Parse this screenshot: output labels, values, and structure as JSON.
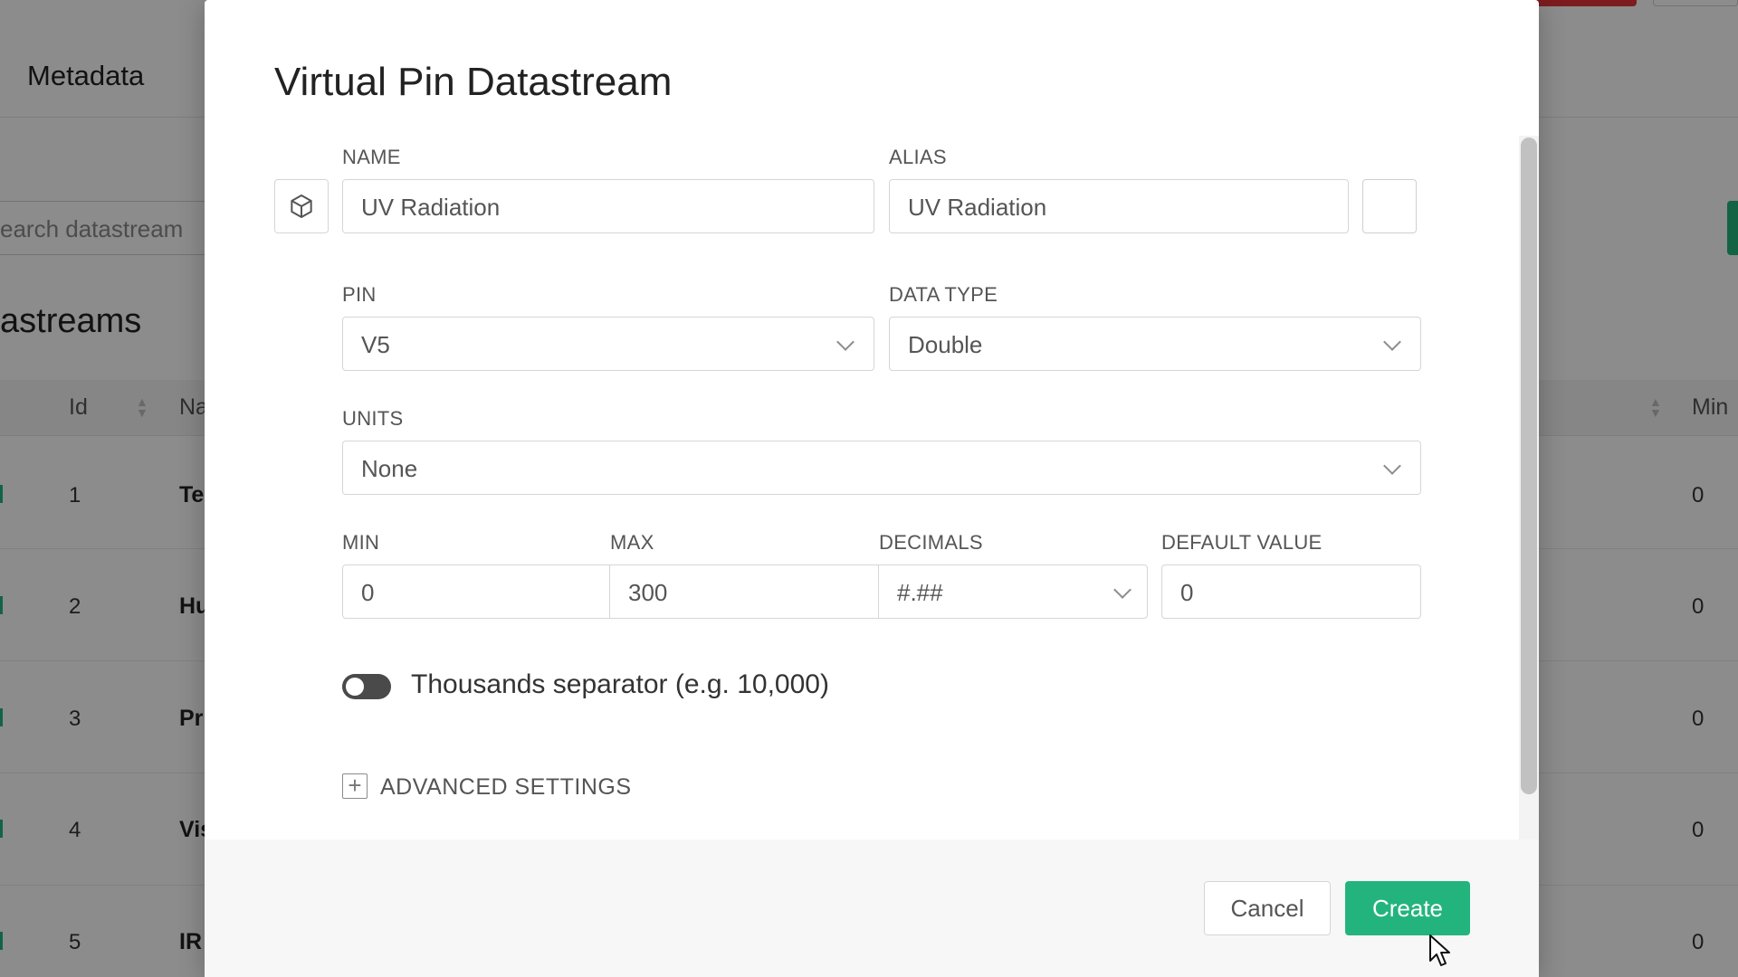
{
  "background": {
    "tab_label": "Metadata",
    "search_placeholder": "earch datastream",
    "section_title": "astreams",
    "table_headers": {
      "id": "Id",
      "name": "Na",
      "min": "Min"
    },
    "rows": [
      {
        "id": "1",
        "name": "Te",
        "min": "0"
      },
      {
        "id": "2",
        "name": "Hu",
        "min": "0"
      },
      {
        "id": "3",
        "name": "Pr",
        "min": "0"
      },
      {
        "id": "4",
        "name": "Vis",
        "min": "0"
      },
      {
        "id": "5",
        "name": "IR",
        "min": "0"
      }
    ]
  },
  "modal": {
    "title": "Virtual Pin Datastream",
    "name": {
      "label": "NAME",
      "value": "UV Radiation"
    },
    "alias": {
      "label": "ALIAS",
      "value": "UV Radiation"
    },
    "pin": {
      "label": "PIN",
      "value": "V5"
    },
    "data_type": {
      "label": "DATA TYPE",
      "value": "Double"
    },
    "units": {
      "label": "UNITS",
      "value": "None"
    },
    "min": {
      "label": "MIN",
      "value": "0"
    },
    "max": {
      "label": "MAX",
      "value": "300"
    },
    "decimals": {
      "label": "DECIMALS",
      "value": "#.##"
    },
    "default_value": {
      "label": "DEFAULT VALUE",
      "value": "0"
    },
    "thousands_separator": {
      "label": "Thousands separator (e.g. 10,000)",
      "enabled": false
    },
    "advanced_settings_label": "ADVANCED SETTINGS",
    "cancel_label": "Cancel",
    "create_label": "Create"
  },
  "colors": {
    "accent": "#23b47e",
    "danger": "#e2343a"
  }
}
